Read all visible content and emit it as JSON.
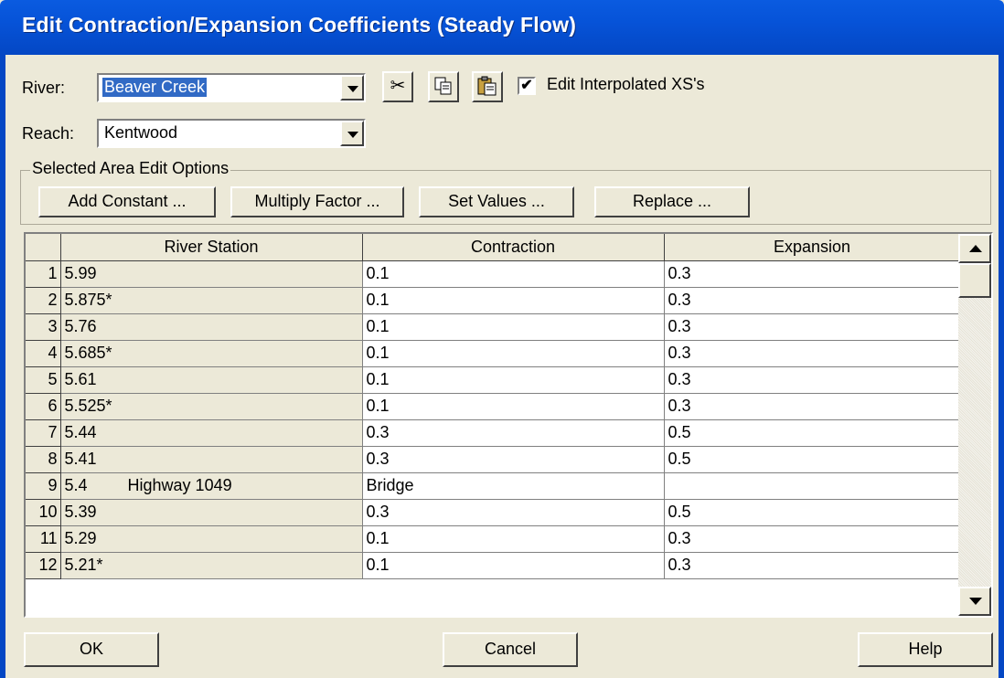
{
  "window": {
    "title": "Edit Contraction/Expansion Coefficients (Steady Flow)"
  },
  "river": {
    "label": "River:",
    "value": "Beaver Creek"
  },
  "reach": {
    "label": "Reach:",
    "value": "Kentwood"
  },
  "toolbar": {
    "cut_icon": "scissors-icon",
    "copy_icon": "copy-icon",
    "paste_icon": "paste-icon",
    "edit_interpolated_label": "Edit Interpolated XS's",
    "edit_interpolated_checked": true
  },
  "selected_area": {
    "legend": "Selected Area Edit Options",
    "add_constant": "Add Constant ...",
    "multiply_factor": "Multiply Factor ...",
    "set_values": "Set Values ...",
    "replace": "Replace ..."
  },
  "table": {
    "columns": [
      "River Station",
      "Contraction",
      "Expansion"
    ],
    "rows": [
      {
        "n": "1",
        "station": "5.99",
        "desc": "",
        "contraction": "0.1",
        "expansion": "0.3"
      },
      {
        "n": "2",
        "station": "5.875*",
        "desc": "",
        "contraction": "0.1",
        "expansion": "0.3"
      },
      {
        "n": "3",
        "station": "5.76",
        "desc": "",
        "contraction": "0.1",
        "expansion": "0.3"
      },
      {
        "n": "4",
        "station": "5.685*",
        "desc": "",
        "contraction": "0.1",
        "expansion": "0.3"
      },
      {
        "n": "5",
        "station": "5.61",
        "desc": "",
        "contraction": "0.1",
        "expansion": "0.3"
      },
      {
        "n": "6",
        "station": "5.525*",
        "desc": "",
        "contraction": "0.1",
        "expansion": "0.3"
      },
      {
        "n": "7",
        "station": "5.44",
        "desc": "",
        "contraction": "0.3",
        "expansion": "0.5"
      },
      {
        "n": "8",
        "station": "5.41",
        "desc": "",
        "contraction": "0.3",
        "expansion": "0.5"
      },
      {
        "n": "9",
        "station": "5.4",
        "desc": "Highway 1049",
        "contraction": "Bridge",
        "expansion": ""
      },
      {
        "n": "10",
        "station": "5.39",
        "desc": "",
        "contraction": "0.3",
        "expansion": "0.5"
      },
      {
        "n": "11",
        "station": "5.29",
        "desc": "",
        "contraction": "0.1",
        "expansion": "0.3"
      },
      {
        "n": "12",
        "station": "5.21*",
        "desc": "",
        "contraction": "0.1",
        "expansion": "0.3"
      }
    ]
  },
  "footer": {
    "ok": "OK",
    "cancel": "Cancel",
    "help": "Help"
  }
}
